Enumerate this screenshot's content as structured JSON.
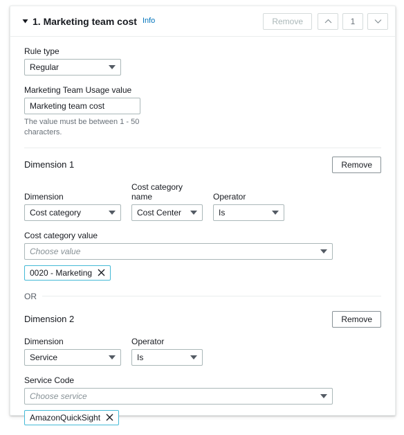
{
  "card": {
    "header": {
      "collapse_icon": "caret-down-icon",
      "title": "1. Marketing team cost",
      "info_label": "Info",
      "remove_label": "Remove",
      "move_up_icon": "chevron-up-icon",
      "order_value": "1",
      "move_down_icon": "chevron-down-icon",
      "remove_disabled": true
    },
    "rule_type": {
      "label": "Rule type",
      "value": "Regular"
    },
    "usage_value": {
      "label": "Marketing Team Usage value",
      "value": "Marketing team cost",
      "constraint": "The value must be between 1 - 50 characters."
    },
    "dimension_1": {
      "title": "Dimension 1",
      "remove_label": "Remove",
      "dimension": {
        "label": "Dimension",
        "value": "Cost category"
      },
      "category_name": {
        "label": "Cost category name",
        "value": "Cost Center"
      },
      "operator": {
        "label": "Operator",
        "value": "Is"
      },
      "value_field": {
        "label": "Cost category value",
        "placeholder": "Choose value",
        "tokens": [
          {
            "label": "0020 - Marketing",
            "remove_icon": "close-icon"
          }
        ]
      }
    },
    "or_separator": "OR",
    "dimension_2": {
      "title": "Dimension 2",
      "remove_label": "Remove",
      "dimension": {
        "label": "Dimension",
        "value": "Service"
      },
      "operator": {
        "label": "Operator",
        "value": "Is"
      },
      "value_field": {
        "label": "Service Code",
        "placeholder": "Choose service",
        "tokens": [
          {
            "label": "AmazonQuickSight",
            "remove_icon": "close-icon"
          }
        ]
      }
    }
  },
  "colors": {
    "link": "#0073bb",
    "token_border": "#44b9d6",
    "text": "#16191f",
    "muted": "#687078",
    "border": "#aab7b8",
    "divider": "#eaeded"
  }
}
